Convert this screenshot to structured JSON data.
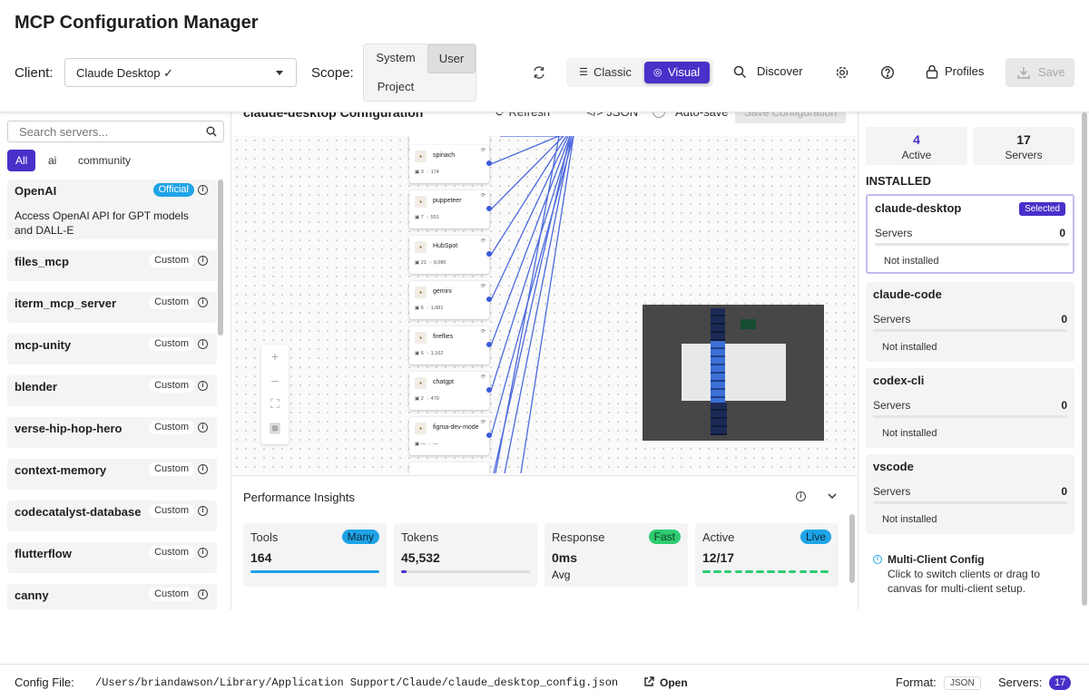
{
  "app": {
    "title": "MCP Configuration Manager"
  },
  "header": {
    "client_label": "Client:",
    "client_value": "Claude Desktop ✓",
    "scope_label": "Scope:",
    "scope_options": [
      "System",
      "User",
      "Project"
    ],
    "scope_selected": "User",
    "view_classic": "Classic",
    "view_visual": "Visual",
    "view_selected": "Visual",
    "discover": "Discover",
    "profiles": "Profiles",
    "save": "Save",
    "accent": "#4a2fc9"
  },
  "sidebar": {
    "search_placeholder": "Search servers...",
    "filters": [
      "All",
      "ai",
      "community"
    ],
    "filter_selected": "All",
    "servers": [
      {
        "name": "OpenAI",
        "badge": "Official",
        "description": "Access OpenAI API for GPT models and DALL-E"
      },
      {
        "name": "files_mcp",
        "badge": "Custom"
      },
      {
        "name": "iterm_mcp_server",
        "badge": "Custom"
      },
      {
        "name": "mcp-unity",
        "badge": "Custom"
      },
      {
        "name": "blender",
        "badge": "Custom"
      },
      {
        "name": "verse-hip-hop-hero",
        "badge": "Custom"
      },
      {
        "name": "context-memory",
        "badge": "Custom"
      },
      {
        "name": "codecatalyst-database",
        "badge": "Custom"
      },
      {
        "name": "flutterflow",
        "badge": "Custom"
      },
      {
        "name": "canny",
        "badge": "Custom"
      }
    ]
  },
  "canvas": {
    "title": "claude-desktop Configuration",
    "refresh": "Refresh",
    "json": "JSON",
    "autosave": "Auto-save",
    "save_config": "Save Configuration",
    "nodes": [
      {
        "name": "spinach",
        "tools": "3",
        "tokens": "174"
      },
      {
        "name": "puppeteer",
        "tools": "7",
        "tokens": "551"
      },
      {
        "name": "HubSpot",
        "tools": "21",
        "tokens": "9,080"
      },
      {
        "name": "gemini",
        "tools": "6",
        "tokens": "1,081"
      },
      {
        "name": "fireflies",
        "tools": "6",
        "tokens": "1,162"
      },
      {
        "name": "chatgpt",
        "tools": "2",
        "tokens": "470"
      },
      {
        "name": "figma-dev-mode",
        "tools": "—",
        "tokens": "—"
      }
    ]
  },
  "performance": {
    "title": "Performance Insights",
    "cards": [
      {
        "title": "Tools",
        "badge": "Many",
        "value": "164",
        "progress": 1.0
      },
      {
        "title": "Tokens",
        "badge": "",
        "value": "45,532",
        "progress": 0.04
      },
      {
        "title": "Response",
        "badge": "Fast",
        "value": "0ms",
        "sub": "Avg"
      },
      {
        "title": "Active",
        "badge": "Live",
        "value": "12/17",
        "segments_on": 12,
        "segments_total": 17
      }
    ]
  },
  "rightpanel": {
    "active_count": "4",
    "active_label": "Active",
    "servers_count": "17",
    "servers_label": "Servers",
    "installed_label": "INSTALLED",
    "clients": [
      {
        "name": "claude-desktop",
        "selected": "Selected",
        "servers_label": "Servers",
        "servers": "0",
        "status": "Not installed"
      },
      {
        "name": "claude-code",
        "servers_label": "Servers",
        "servers": "0",
        "status": "Not installed"
      },
      {
        "name": "codex-cli",
        "servers_label": "Servers",
        "servers": "0",
        "status": "Not installed"
      },
      {
        "name": "vscode",
        "servers_label": "Servers",
        "servers": "0",
        "status": "Not installed"
      }
    ],
    "multi_title": "Multi-Client Config",
    "multi_desc": "Click to switch clients or drag to canvas for multi-client setup."
  },
  "footer": {
    "config_label": "Config File:",
    "config_path": "/Users/briandawson/Library/Application Support/Claude/claude_desktop_config.json",
    "open": "Open",
    "format_label": "Format:",
    "format_value": "JSON",
    "servers_label": "Servers:",
    "servers_value": "17"
  }
}
